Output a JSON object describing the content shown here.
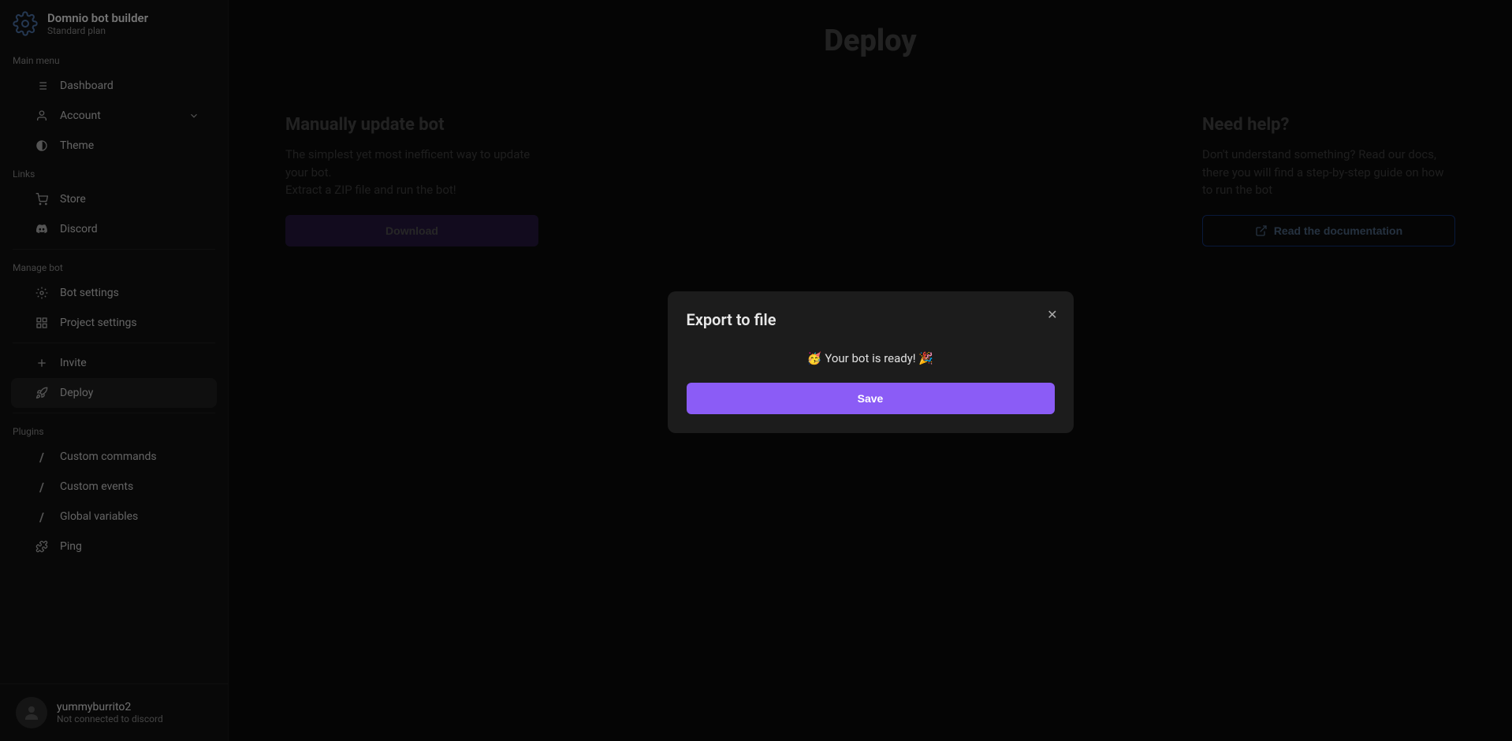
{
  "brand": {
    "title": "Domnio bot builder",
    "subtitle": "Standard plan"
  },
  "sections": {
    "main_menu": "Main menu",
    "links": "Links",
    "manage_bot": "Manage bot",
    "plugins": "Plugins"
  },
  "nav": {
    "dashboard": "Dashboard",
    "account": "Account",
    "theme": "Theme",
    "store": "Store",
    "discord": "Discord",
    "bot_settings": "Bot settings",
    "project_settings": "Project settings",
    "invite": "Invite",
    "deploy": "Deploy",
    "custom_commands": "Custom commands",
    "custom_events": "Custom events",
    "global_variables": "Global variables",
    "ping": "Ping"
  },
  "user": {
    "name": "yummyburrito2",
    "status": "Not connected to discord"
  },
  "page": {
    "title": "Deploy"
  },
  "card_update": {
    "title": "Manually update bot",
    "desc1": "The simplest yet most inefficent way to update your bot.",
    "desc2": "Extract a ZIP file and run the bot!",
    "button": "Download"
  },
  "card_help": {
    "title": "Need help?",
    "desc": "Don't understand something? Read our docs, there you will find a step-by-step guide on how to run the bot",
    "button": "Read the documentation"
  },
  "modal": {
    "title": "Export to file",
    "message": "🥳 Your bot is ready! 🎉",
    "save": "Save"
  }
}
